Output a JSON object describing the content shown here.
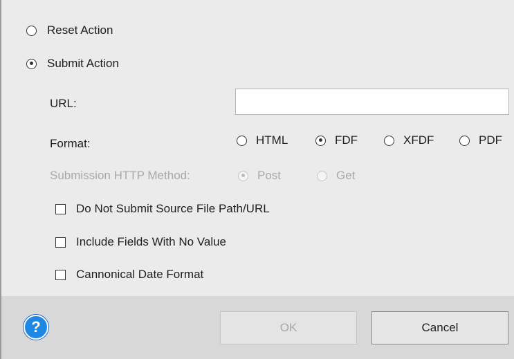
{
  "action_type": {
    "reset_label": "Reset Action",
    "submit_label": "Submit Action",
    "selected": "submit"
  },
  "url": {
    "label": "URL:",
    "value": ""
  },
  "format": {
    "label": "Format:",
    "options": [
      "HTML",
      "FDF",
      "XFDF",
      "PDF"
    ],
    "selected": "FDF"
  },
  "http_method": {
    "label": "Submission HTTP Method:",
    "options": [
      "Post",
      "Get"
    ],
    "selected": "Post",
    "disabled": true
  },
  "checkboxes": [
    {
      "label": "Do Not Submit Source File Path/URL",
      "checked": false
    },
    {
      "label": "Include Fields With No Value",
      "checked": false
    },
    {
      "label": "Cannonical Date Format",
      "checked": false
    }
  ],
  "footer": {
    "help_glyph": "?",
    "ok_label": "OK",
    "ok_disabled": true,
    "cancel_label": "Cancel"
  }
}
